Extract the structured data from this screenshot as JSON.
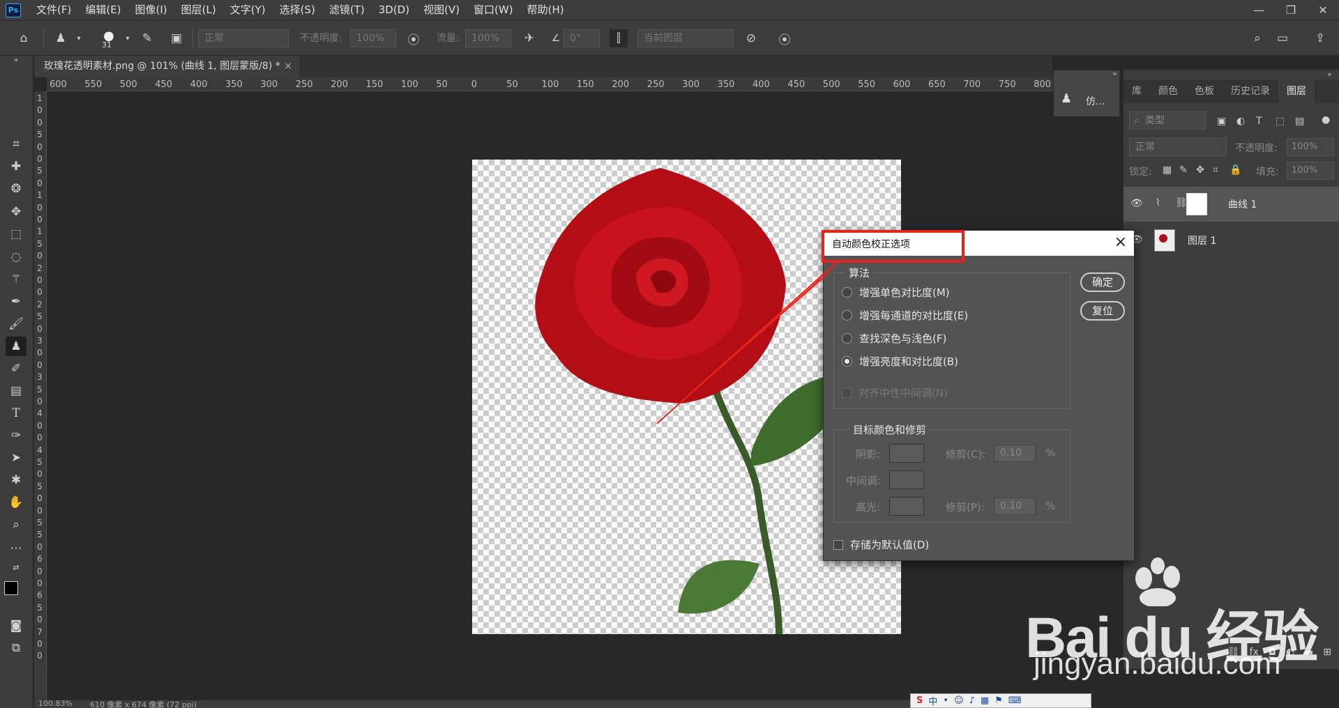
{
  "menubar": {
    "logo": "Ps",
    "items": [
      "文件(F)",
      "编辑(E)",
      "图像(I)",
      "图层(L)",
      "文字(Y)",
      "选择(S)",
      "滤镜(T)",
      "3D(D)",
      "视图(V)",
      "窗口(W)",
      "帮助(H)"
    ],
    "window_controls": [
      "minimize-icon",
      "restore-icon",
      "close-icon"
    ]
  },
  "options_bar": {
    "brush_size": "31",
    "mode_value": "正常",
    "opacity_label": "不透明度:",
    "opacity_value": "100%",
    "flow_label": "流量:",
    "flow_value": "100%",
    "angle_value": "0°",
    "sample_value": "当前图层"
  },
  "document": {
    "tab_title": "玫瑰花透明素材.png @ 101% (曲线 1, 图层蒙版/8) *",
    "tab_close": "×"
  },
  "ruler": {
    "horizontal_ticks": [
      "600",
      "550",
      "500",
      "450",
      "400",
      "350",
      "300",
      "250",
      "200",
      "150",
      "100",
      "50",
      "0",
      "50",
      "100",
      "150",
      "200",
      "250",
      "300",
      "350",
      "400",
      "450",
      "500",
      "550",
      "600",
      "650",
      "700",
      "750",
      "800"
    ],
    "vertical_ticks": [
      "1",
      "0",
      "0",
      "5",
      "0",
      "0",
      "5",
      "0",
      "1",
      "0",
      "0",
      "1",
      "5",
      "0",
      "2",
      "0",
      "0",
      "2",
      "5",
      "0",
      "3",
      "0",
      "0",
      "3",
      "5",
      "0",
      "4",
      "0",
      "0",
      "4",
      "5",
      "0",
      "5",
      "0",
      "0",
      "5",
      "5",
      "0",
      "6",
      "0",
      "0",
      "6",
      "5",
      "0",
      "7",
      "0",
      "0"
    ]
  },
  "mini_panel": {
    "label": "仿..."
  },
  "layers_panel": {
    "tabs": [
      "库",
      "颜色",
      "色板",
      "历史记录",
      "图层"
    ],
    "active_tab": "图层",
    "filter_placeholder": "类型",
    "blend_mode": "正常",
    "opacity_label": "不透明度:",
    "opacity_value": "100%",
    "lock_label": "锁定:",
    "fill_label": "填充:",
    "fill_value": "100%",
    "layers": [
      {
        "name": "曲线 1",
        "selected": true
      },
      {
        "name": "图层 1",
        "selected": false
      }
    ]
  },
  "dialog": {
    "title": "自动颜色校正选项",
    "ok_label": "确定",
    "reset_label": "复位",
    "algorithm_label": "算法",
    "options": [
      {
        "label": "增强单色对比度(M)",
        "checked": false
      },
      {
        "label": "增强每通道的对比度(E)",
        "checked": false
      },
      {
        "label": "查找深色与浅色(F)",
        "checked": false
      },
      {
        "label": "增强亮度和对比度(B)",
        "checked": true
      }
    ],
    "snap_neutral": "对齐中性中间调(N)",
    "target_group_label": "目标颜色和修剪",
    "shadows_label": "阴影:",
    "midtones_label": "中间调:",
    "highlights_label": "高光:",
    "clip_shadow_label": "修剪(C):",
    "clip_shadow_value": "0.10",
    "clip_highlight_label": "修剪(P):",
    "clip_highlight_value": "0.10",
    "percent": "%",
    "save_default": "存储为默认值(D)"
  },
  "status": {
    "zoom": "100.83%",
    "size": "610 像素 x 674 像素 (72 ppi)"
  },
  "ime": {
    "items": [
      "中",
      "•",
      "☺",
      "♪",
      "▦",
      "⚑",
      "⌨"
    ]
  },
  "watermark": {
    "line1": "Bai du 经验",
    "line2": "jingyan.baidu.com"
  },
  "colors": {
    "accent_red": "#e8231c",
    "ps_blue": "#31a8ff"
  }
}
